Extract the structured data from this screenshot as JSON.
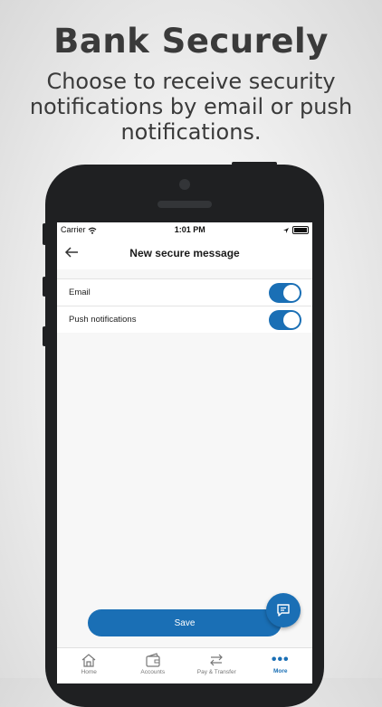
{
  "promo": {
    "headline": "Bank Securely",
    "subline": "Choose to receive security notifications by email or push notifications."
  },
  "status_bar": {
    "carrier": "Carrier",
    "time": "1:01 PM"
  },
  "nav": {
    "title": "New secure message",
    "back_icon": "arrow-left-icon"
  },
  "settings": [
    {
      "label": "Email",
      "enabled": true
    },
    {
      "label": "Push notifications",
      "enabled": true
    }
  ],
  "actions": {
    "save_label": "Save",
    "fab_icon": "chat-icon"
  },
  "tabs": [
    {
      "label": "Home",
      "icon": "home-icon",
      "active": false
    },
    {
      "label": "Accounts",
      "icon": "wallet-icon",
      "active": false
    },
    {
      "label": "Pay & Transfer",
      "icon": "transfer-icon",
      "active": false
    },
    {
      "label": "More",
      "icon": "more-dots-icon",
      "active": true
    }
  ],
  "colors": {
    "accent": "#1a6fb5",
    "phone_body": "#1f2022",
    "headline_text": "#3a3a3a"
  }
}
